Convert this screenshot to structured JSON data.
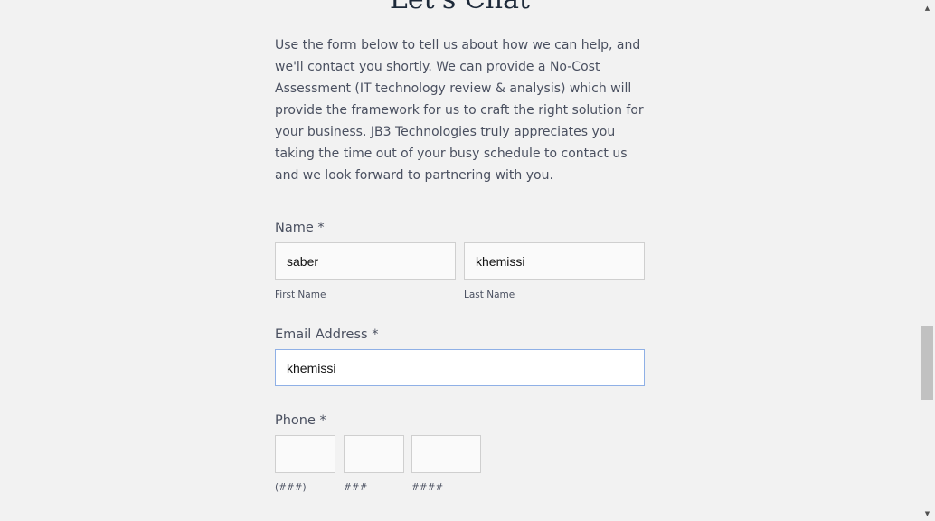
{
  "form": {
    "heading": "Let's Chat",
    "intro": "Use the form below to tell us about how we can help, and we'll contact you shortly. We can provide a No-Cost Assessment (IT technology review & analysis) which will provide the framework for us to craft the right solution for your business. JB3 Technologies truly appreciates you taking the time out of your busy schedule to contact us and we look forward to partnering with you.",
    "name": {
      "label": "Name *",
      "first_value": "saber",
      "first_sublabel": "First Name",
      "last_value": "khemissi",
      "last_sublabel": "Last Name"
    },
    "email": {
      "label": "Email Address *",
      "value": "khemissi"
    },
    "phone": {
      "label": "Phone *",
      "area_value": "",
      "area_sublabel": "(###)",
      "prefix_value": "",
      "prefix_sublabel": "###",
      "line_value": "",
      "line_sublabel": "####"
    }
  },
  "scrollbar": {
    "up_icon": "triangle-up-icon",
    "down_icon": "triangle-down-icon"
  }
}
